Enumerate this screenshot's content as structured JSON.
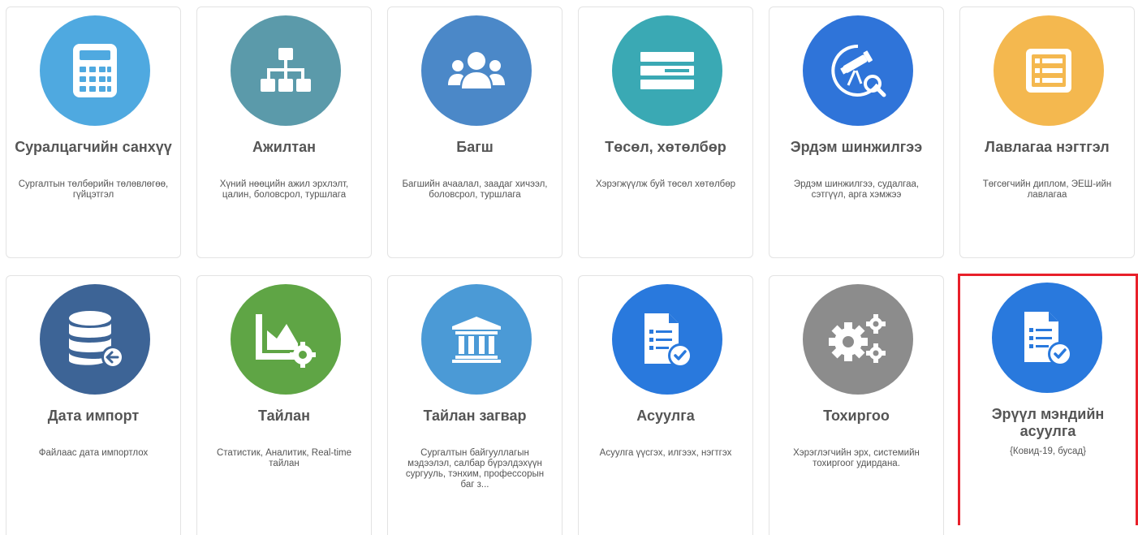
{
  "tiles": [
    {
      "title": "Суралцагчийн санхүү",
      "description": "Сургалтын төлбөрийн төлөвлөгөө, гүйцэтгэл",
      "icon": "calculator-icon",
      "color": "#4fa9e0"
    },
    {
      "title": "Ажилтан",
      "description": "Хүний нөөцийн ажил эрхлэлт, цалин, боловсрол, туршлага",
      "icon": "org-chart-icon",
      "color": "#5b9aaa"
    },
    {
      "title": "Багш",
      "description": "Багшийн ачаалал, заадаг хичээл, боловсрол, туршлага",
      "icon": "users-icon",
      "color": "#4b88c8"
    },
    {
      "title": "Төсөл, хөтөлбөр",
      "description": "Хэрэгжүүлж буй төсөл хөтөлбөр",
      "icon": "list-bars-icon",
      "color": "#3aa9b4"
    },
    {
      "title": "Эрдэм шинжилгээ",
      "description": "Эрдэм шинжилгээ, судалгаа, сэтгүүл, арга хэмжээ",
      "icon": "telescope-search-icon",
      "color": "#2f74d9"
    },
    {
      "title": "Лавлагаа нэгтгэл",
      "description": "Төгсөгчийн диплом, ЭЕШ-ийн лавлагаа",
      "icon": "document-list-icon",
      "color": "#f4b84f"
    },
    {
      "title": "Дата импорт",
      "description": "Файлаас дата импортлох",
      "icon": "database-import-icon",
      "color": "#3d6496"
    },
    {
      "title": "Тайлан",
      "description": "Статистик, Аналитик, Real-time тайлан",
      "icon": "chart-settings-icon",
      "color": "#5fa545"
    },
    {
      "title": "Тайлан загвар",
      "description": "Сургалтын байгууллагын мэдээлэл, салбар бүрэлдэхүүн сургууль, тэнхим, профессорын баг з...",
      "icon": "institution-icon",
      "color": "#4b9ad6"
    },
    {
      "title": "Асуулга",
      "description": "Асуулга үүсгэх, илгээх, нэгтгэх",
      "icon": "checklist-check-icon",
      "color": "#2979dd"
    },
    {
      "title": "Тохиргоо",
      "description": "Хэрэглэгчийн эрх, системийн тохиргоог удирдана.",
      "icon": "gears-icon",
      "color": "#8c8c8c"
    },
    {
      "title": "Эрүүл мэндийн асуулга",
      "description": "{Ковид-19, бусад}",
      "icon": "checklist-check-icon",
      "color": "#2979dd"
    }
  ],
  "highlight_color": "#e8202a"
}
